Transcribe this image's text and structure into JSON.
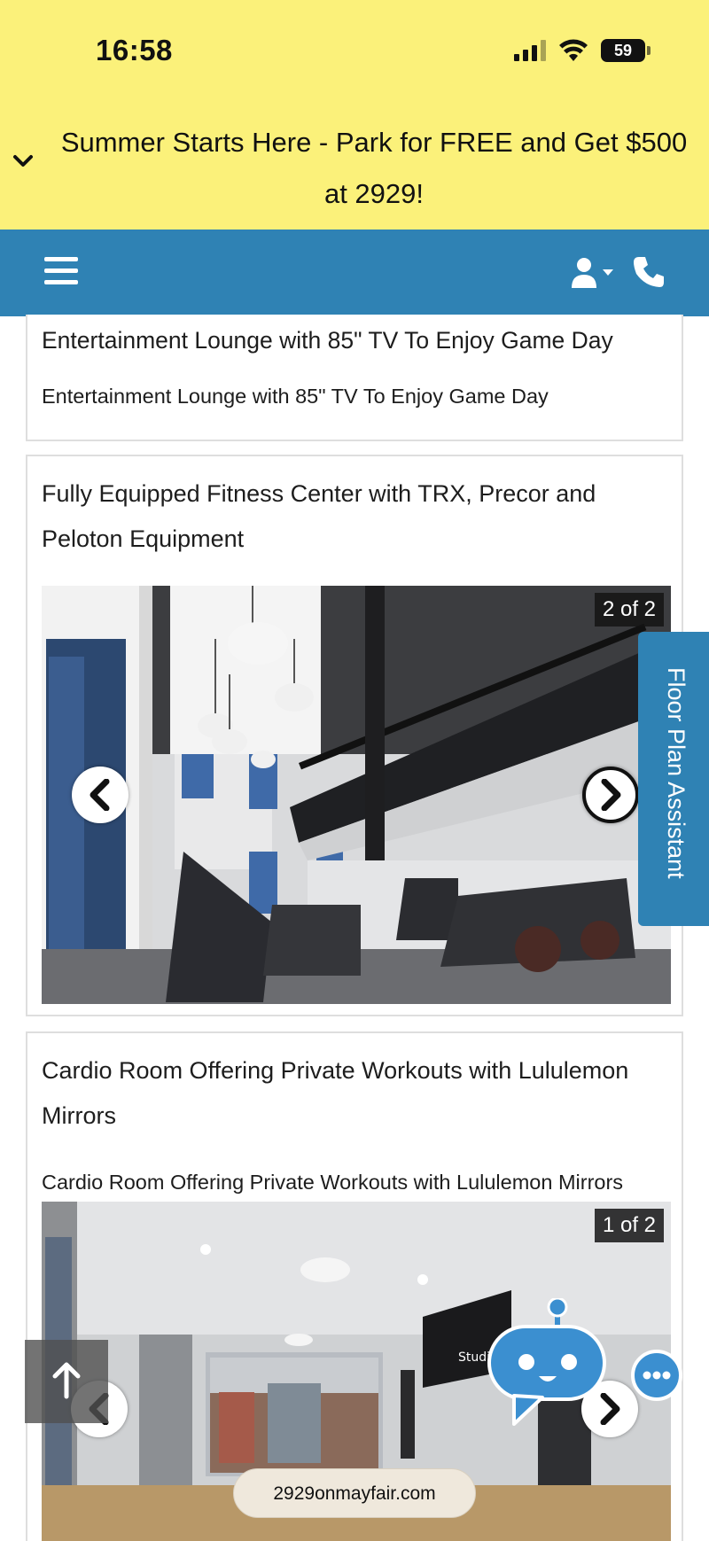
{
  "status_bar": {
    "time": "16:58",
    "battery": "59"
  },
  "promo": {
    "text": "Summer Starts Here - Park for FREE and Get $500 at 2929!"
  },
  "amenities": [
    {
      "title": "Entertainment Lounge with 85\" TV To Enjoy Game Day",
      "description": "Entertainment Lounge with 85\" TV To Enjoy Game Day"
    },
    {
      "title": "Fully Equipped Fitness Center with TRX, Precor and Peloton Equipment",
      "counter": "2 of 2"
    },
    {
      "title": "Cardio Room Offering Private Workouts with Lululemon Mirrors",
      "description": "Cardio Room Offering Private Workouts with Lululemon Mirrors",
      "counter": "1 of 2",
      "tv_logo": "Studio"
    }
  ],
  "side_tab": {
    "label": "Floor Plan Assistant"
  },
  "browser": {
    "url": "2929onmayfair.com"
  },
  "icons": [
    "chevron-down-icon",
    "menu-icon",
    "user-icon",
    "phone-icon",
    "arrow-left-icon",
    "arrow-right-icon",
    "arrow-up-icon",
    "chatbot-icon",
    "more-dots-icon"
  ],
  "colors": {
    "banner": "#fbf17a",
    "header": "#2f82b4",
    "chat": "#3b8fd0"
  }
}
